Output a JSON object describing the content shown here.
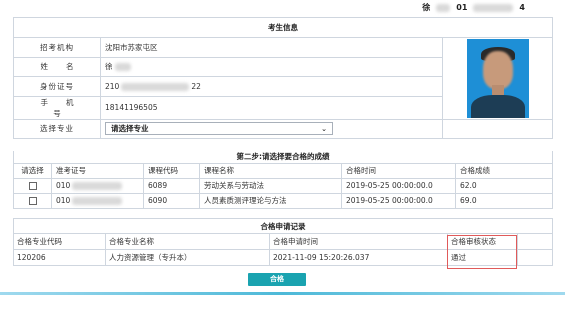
{
  "top_user": {
    "name": "徐",
    "id_prefix": "01",
    "id_suffix": "4"
  },
  "candidate_info": {
    "title": "考生信息",
    "rows": [
      {
        "label": "招考机构",
        "value": "沈阳市苏家屯区"
      },
      {
        "label": "姓名",
        "value": "徐"
      },
      {
        "label": "身份证号",
        "value_prefix": "210",
        "value_suffix": "22"
      },
      {
        "label": "手机号",
        "value": "18141196505"
      }
    ],
    "major_label": "选择专业",
    "major_select": {
      "selected": "请选择专业"
    }
  },
  "step2": {
    "title": "第二步:请选择要合格的成绩",
    "headers": [
      "请选择",
      "准考证号",
      "课程代码",
      "课程名称",
      "合格时间",
      "合格成绩"
    ],
    "rows": [
      {
        "ticket_prefix": "010",
        "course_code": "6089",
        "course_name": "劳动关系与劳动法",
        "pass_time": "2019-05-25 00:00:00.0",
        "score": "62.0"
      },
      {
        "ticket_prefix": "010",
        "course_code": "6090",
        "course_name": "人员素质测评理论与方法",
        "pass_time": "2019-05-25 00:00:00.0",
        "score": "69.0"
      }
    ]
  },
  "application": {
    "title": "合格申请记录",
    "headers": [
      "合格专业代码",
      "合格专业名称",
      "合格申请时间",
      "合格审核状态"
    ],
    "rows": [
      {
        "code": "120206",
        "name": "人力资源管理（专升本）",
        "time": "2021-11-09 15:20:26.037",
        "status": "通过"
      }
    ]
  },
  "submit_button": "合格",
  "colors": {
    "accent": "#1aa3b0",
    "highlight_border": "#e05a5a",
    "grid_border": "#cfd6df"
  }
}
